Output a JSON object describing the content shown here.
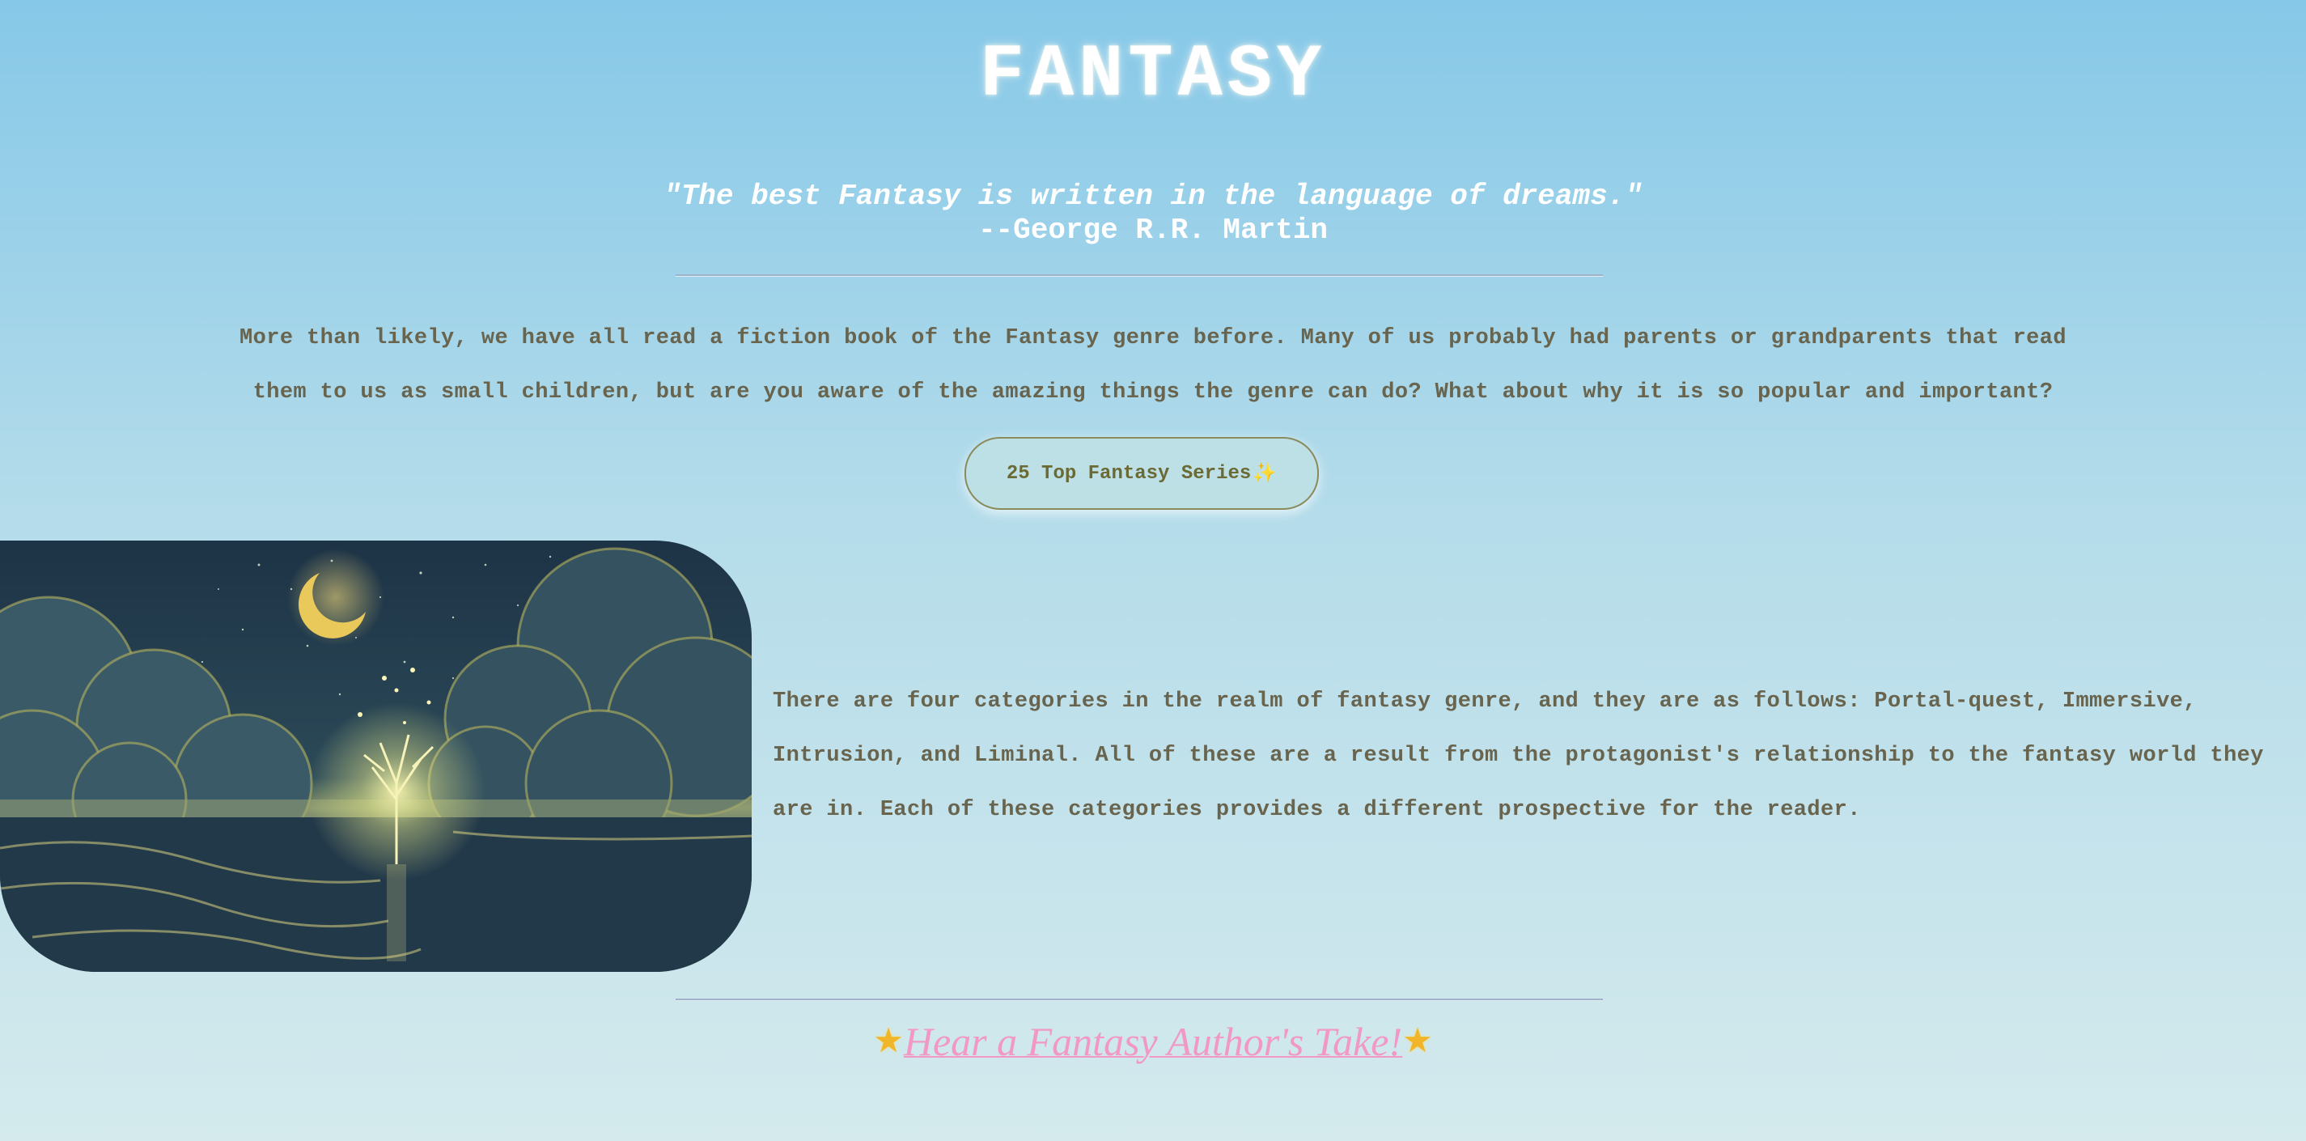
{
  "page": {
    "title": "FANTASY"
  },
  "quote": {
    "text": "\"The best Fantasy is written in the language of dreams.\"",
    "author": "--George R.R. Martin"
  },
  "intro": {
    "text": "More than likely, we have all read a fiction book of the Fantasy genre before. Many of us probably had parents or grandparents that read them to us as small children, but are you aware of the amazing things the genre can do? What about why it is so popular and important?"
  },
  "series_button": {
    "label": "25 Top Fantasy Series",
    "icon": "sparkles-icon",
    "icon_glyph": "✨"
  },
  "hero_image": {
    "icon": "fantasy-night-landscape-image"
  },
  "categories": {
    "text": "There are four categories in the realm of fantasy genre, and they are as follows: Portal-quest, Immersive, Intrusion, and Liminal. All of these are a result from the protagonist's relationship to the fantasy world they are in. Each of these categories provides a different prospective for the reader."
  },
  "author_link": {
    "label": "Hear a Fantasy Author's Take!",
    "icon": "star-icon",
    "icon_glyph": "★"
  },
  "colors": {
    "background_top": "#86c8e8",
    "background_bottom": "#d4eaed",
    "heading": "#ffffff",
    "body_text": "#68644e",
    "link": "#f198c6",
    "button_border": "#8a8a5a"
  }
}
